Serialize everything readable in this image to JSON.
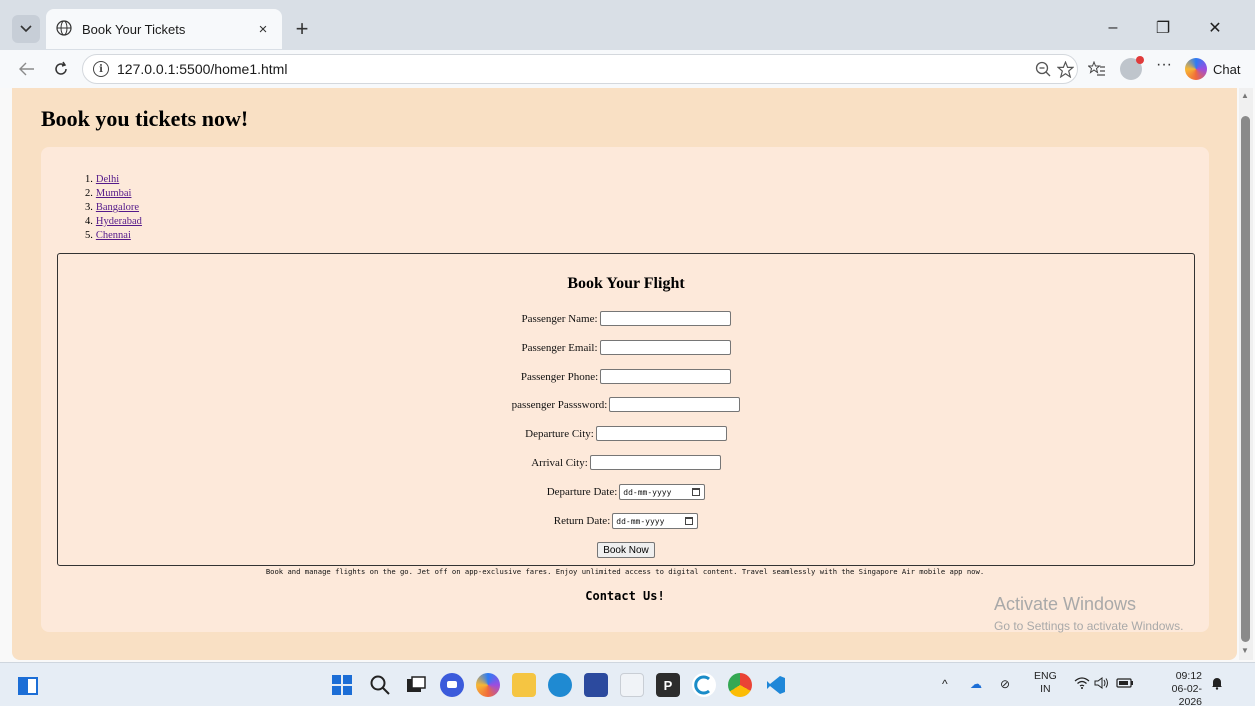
{
  "browser": {
    "tab_title": "Book Your Tickets",
    "tab_close": "×",
    "new_tab": "+",
    "url": "127.0.0.1:5500/home1.html",
    "chat_label": "Chat",
    "more": "···",
    "window_minimize": "–",
    "window_restore": "❐",
    "window_close": "✕"
  },
  "page": {
    "heading": "Book you tickets now!",
    "cities": [
      {
        "num": "1.",
        "label": "Delhi"
      },
      {
        "num": "2.",
        "label": "Mumbai"
      },
      {
        "num": "3.",
        "label": "Bangalore"
      },
      {
        "num": "4.",
        "label": "Hyderabad"
      },
      {
        "num": "5.",
        "label": "Chennai"
      }
    ],
    "form": {
      "title": "Book Your Flight",
      "fields": {
        "name": "Passenger Name:",
        "email": "Passenger Email:",
        "phone": "Passenger Phone:",
        "password": "passenger Passsword:",
        "departure_city": "Departure City:",
        "arrival_city": "Arrival City:",
        "departure_date": "Departure Date:",
        "return_date": "Return Date:"
      },
      "date_placeholder": "dd-mm-yyyy",
      "submit_label": "Book Now"
    },
    "promo": "Book and manage flights on the go. Jet off on app-exclusive fares. Enjoy unlimited access to digital content. Travel seamlessly with the Singapore Air mobile app now.",
    "contact": "Contact Us!"
  },
  "watermark": {
    "title": "Activate Windows",
    "subtitle": "Go to Settings to activate Windows."
  },
  "taskbar": {
    "lang_line1": "ENG",
    "lang_line2": "IN",
    "time": "09:12",
    "date": "06-02-2026"
  },
  "colors": {
    "page_bg": "#f9e0c4",
    "card_bg": "#fde9da",
    "link": "#551a8b"
  }
}
